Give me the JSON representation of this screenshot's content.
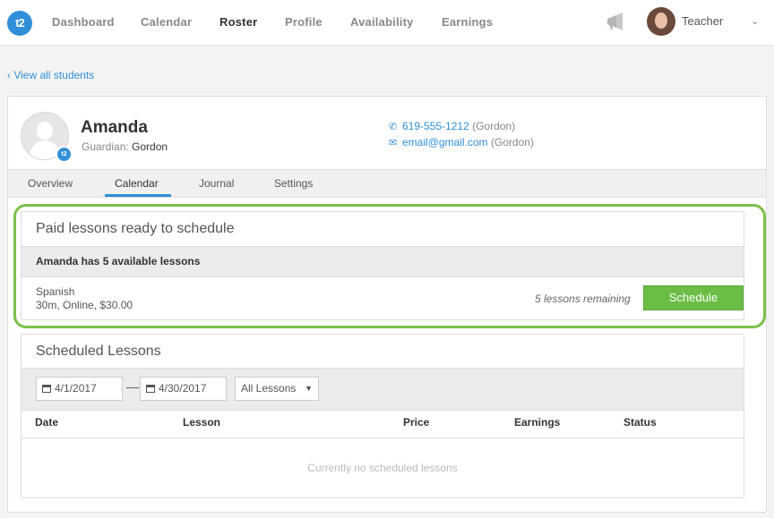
{
  "nav": {
    "logo": "t2",
    "items": [
      "Dashboard",
      "Calendar",
      "Roster",
      "Profile",
      "Availability",
      "Earnings"
    ],
    "active": "Roster",
    "user_label": "Teacher",
    "icons": {
      "announcements": "megaphone-icon",
      "user_menu": "chevron-down-icon"
    }
  },
  "back_link": "View all students",
  "student": {
    "name": "Amanda",
    "guardian_label": "Guardian:",
    "guardian_name": "Gordon",
    "phone": "619-555-1212",
    "phone_owner": "(Gordon)",
    "email": "email@gmail.com",
    "email_owner": "(Gordon)"
  },
  "tabs": [
    "Overview",
    "Calendar",
    "Journal",
    "Settings"
  ],
  "active_tab": "Calendar",
  "paid": {
    "title": "Paid lessons ready to schedule",
    "summary": "Amanda has 5 available lessons",
    "lesson_name": "Spanish",
    "lesson_details": "30m, Online, $30.00",
    "remaining": "5 lessons remaining",
    "button": "Schedule"
  },
  "scheduled": {
    "title": "Scheduled Lessons",
    "date_from": "4/1/2017",
    "dash": "—",
    "date_to": "4/30/2017",
    "lesson_filter": "All Lessons",
    "columns": [
      "Date",
      "Lesson",
      "Price",
      "Earnings",
      "Status"
    ],
    "empty": "Currently no scheduled lessons"
  },
  "colors": {
    "accent": "#2f8fd8",
    "highlight": "#7cbf4a",
    "button": "#6cbd45"
  }
}
